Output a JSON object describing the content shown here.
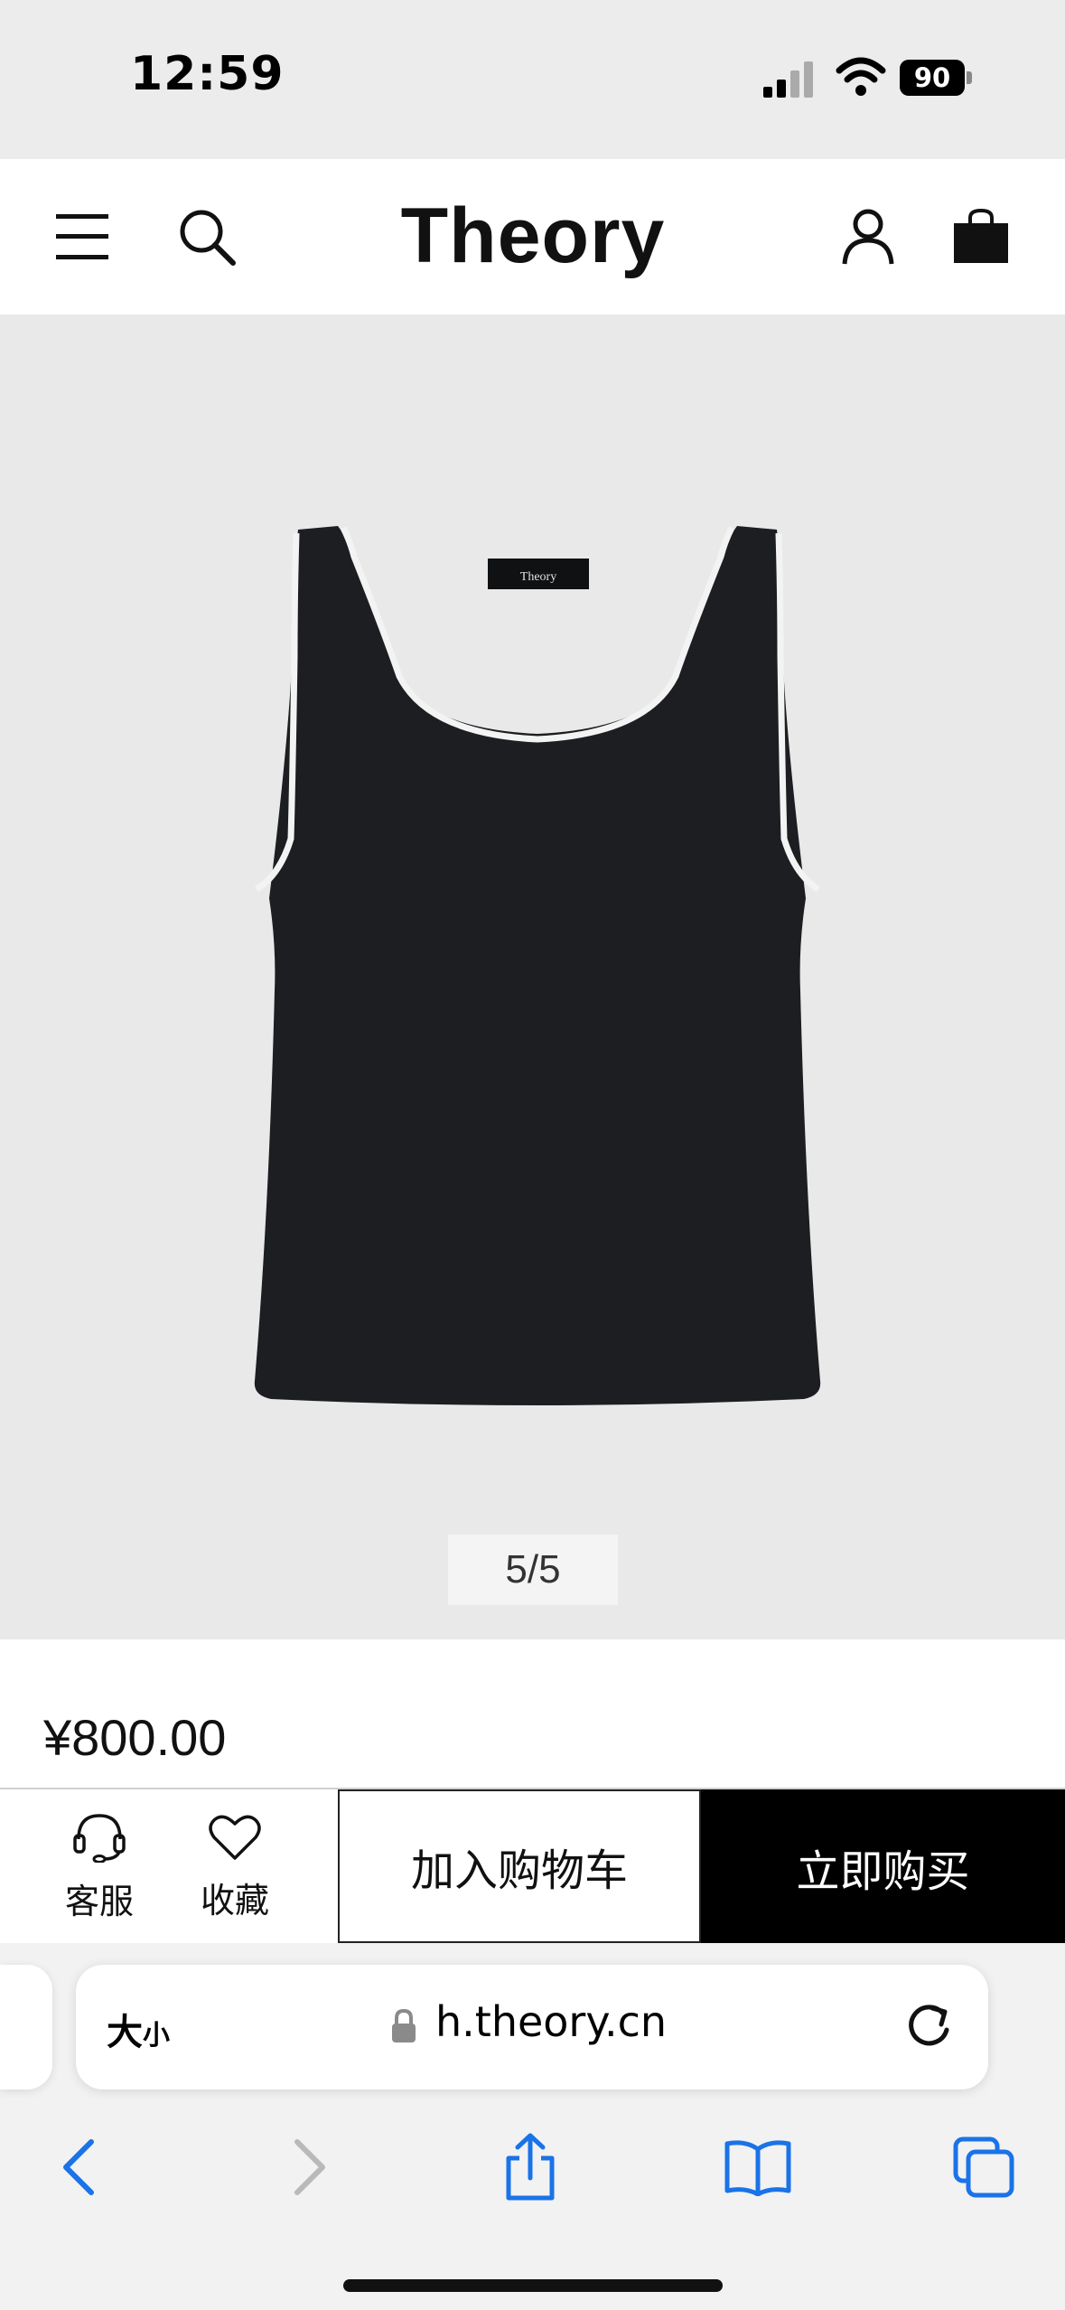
{
  "status_bar": {
    "time": "12:59",
    "battery": "90"
  },
  "header": {
    "logo": "Theory"
  },
  "product": {
    "garment_label": "Theory",
    "image_counter": "5/5",
    "price": "¥800.00"
  },
  "actions": {
    "service_label": "客服",
    "favorite_label": "收藏",
    "add_to_cart": "加入购物车",
    "buy_now": "立即购买"
  },
  "browser": {
    "text_size_big": "大",
    "text_size_small": "小",
    "url": "h.theory.cn"
  },
  "colors": {
    "accent_blue": "#1a73e8",
    "image_bg": "#e8e9e8",
    "buy_bg": "#000000"
  },
  "icons": [
    "menu-icon",
    "search-icon",
    "account-icon",
    "shopping-bag-icon",
    "headset-icon",
    "heart-icon",
    "lock-icon",
    "reload-icon",
    "back-icon",
    "forward-icon",
    "share-icon",
    "bookmarks-icon",
    "tabs-icon"
  ]
}
